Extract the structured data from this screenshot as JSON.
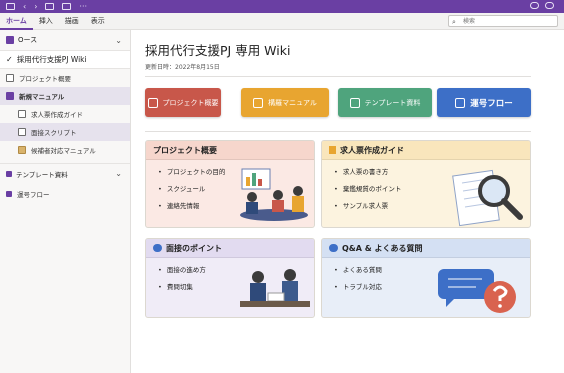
{
  "titlebar": {
    "glyphs": [
      "‹",
      "›",
      "···"
    ]
  },
  "menu": {
    "items": [
      "ホーム",
      "挿入",
      "描画",
      "表示"
    ],
    "active_index": 0
  },
  "search": {
    "placeholder": "検索"
  },
  "sidebar": {
    "notebook": "Oース",
    "section": "採用代行支援PJ Wiki",
    "pages": [
      {
        "label": "プロジェクト概要",
        "level": 0,
        "selected": false
      },
      {
        "label": "新規マニュアル",
        "level": 0,
        "selected": true
      },
      {
        "label": "求人票作成ガイド",
        "level": 1,
        "selected": false
      },
      {
        "label": "面接スクリプト",
        "level": 1,
        "selected": true
      },
      {
        "label": "候補者対応マニュアル",
        "level": 1,
        "selected": false
      }
    ],
    "group": "テンプレート資料",
    "footer_page": "運号フロー"
  },
  "page": {
    "title": "採用代行支援PJ 専用 Wiki",
    "date": "更新日時：2022年8月15日"
  },
  "buttons": [
    {
      "label": "プロジェクト概要",
      "color": "#c8574a"
    },
    {
      "label": "構羅マニュアル",
      "color": "#e8a530"
    },
    {
      "label": "テンプレート資料",
      "color": "#4fa47d"
    },
    {
      "label": "運号フロー",
      "color": "#3d6fc7"
    }
  ],
  "cards": [
    {
      "title": "プロジェクト概要",
      "items": [
        "プロジェクトの目的",
        "スクジュール",
        "連絡先情報"
      ],
      "bg": "#fbe9e4",
      "head": "#f6d6cc"
    },
    {
      "title": "求人票作成ガイド",
      "items": [
        "求人票の書き方",
        "棄鑑規質のポイント",
        "サンプル求人票"
      ],
      "bg": "#fcf3df",
      "head": "#f9e6bc"
    },
    {
      "title": "面接のポイント",
      "items": [
        "面接の進め方",
        "費問切集"
      ],
      "bg": "#f0ecf7",
      "head": "#e2dbf0"
    },
    {
      "title": "Q&A & よくある質問",
      "items": [
        "よくある質問",
        "トラブル対応"
      ],
      "bg": "#e8eef8",
      "head": "#d4e0f3"
    }
  ]
}
